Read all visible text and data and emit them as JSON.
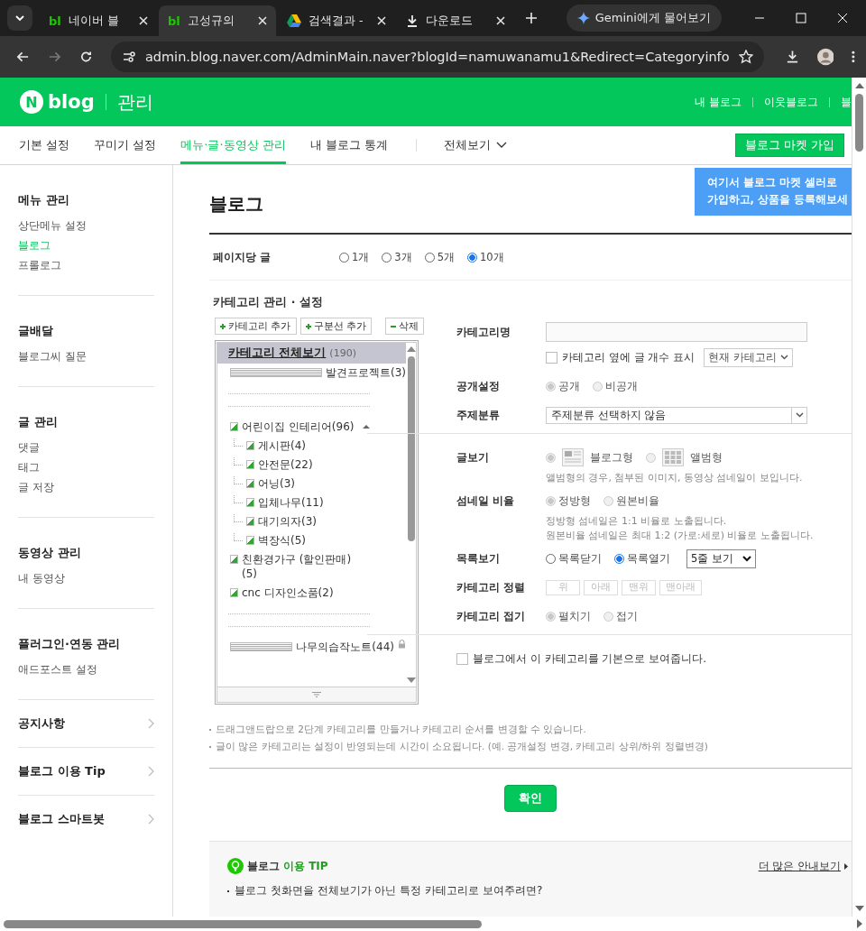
{
  "browser": {
    "tabs": [
      {
        "title": "네이버 블",
        "kind": "text",
        "icon_text": "bl",
        "selected": false
      },
      {
        "title": "고성규의",
        "kind": "text",
        "icon_text": "bl",
        "selected": true
      },
      {
        "title": "검색결과 -",
        "kind": "drive",
        "selected": false
      },
      {
        "title": "다운로드",
        "kind": "download",
        "selected": false
      }
    ],
    "ai_button": "Gemini에게 물어보기",
    "url": "admin.blog.naver.com/AdminMain.naver?blogId=namuwanamu1&Redirect=Categoryinfo"
  },
  "header": {
    "logo_letter": "N",
    "logo_word": "blog",
    "title": "관리",
    "links": [
      "내 블로그",
      "이웃블로그",
      "블"
    ]
  },
  "nav": {
    "items": [
      {
        "label": "기본 설정",
        "selected": false
      },
      {
        "label": "꾸미기 설정",
        "selected": false
      },
      {
        "label": "메뉴·글·동영상 관리",
        "selected": true
      },
      {
        "label": "내 블로그 통계",
        "selected": false
      }
    ],
    "dropdown": "전체보기",
    "market_button": "블로그 마켓 가입",
    "tooltip": "여기서 블로그 마켓 셀러로\n가입하고, 상품을 등록해보세"
  },
  "sidebar": [
    {
      "title": "메뉴 관리",
      "kind": "group",
      "items": [
        {
          "label": "상단메뉴 설정",
          "selected": false
        },
        {
          "label": "블로그",
          "selected": true
        },
        {
          "label": "프롤로그",
          "selected": false
        }
      ]
    },
    {
      "title": "글배달",
      "kind": "group",
      "items": [
        {
          "label": "블로그씨 질문",
          "selected": false
        }
      ]
    },
    {
      "title": "글 관리",
      "kind": "group",
      "items": [
        {
          "label": "댓글",
          "selected": false
        },
        {
          "label": "태그",
          "selected": false
        },
        {
          "label": "글 저장",
          "selected": false
        }
      ]
    },
    {
      "title": "동영상 관리",
      "kind": "group",
      "items": [
        {
          "label": "내 동영상",
          "selected": false
        }
      ]
    },
    {
      "title": "플러그인·연동 관리",
      "kind": "group",
      "items": [
        {
          "label": "애드포스트 설정",
          "selected": false
        }
      ]
    },
    {
      "title": "공지사항",
      "kind": "link"
    },
    {
      "title": "블로그 이용 Tip",
      "kind": "link"
    },
    {
      "title": "블로그 스마트봇",
      "kind": "link"
    }
  ],
  "page_title": "블로그",
  "per_page": {
    "label": "페이지당 글",
    "options": [
      {
        "label": "1개",
        "selected": false
      },
      {
        "label": "3개",
        "selected": false
      },
      {
        "label": "5개",
        "selected": false
      },
      {
        "label": "10개",
        "selected": true
      }
    ]
  },
  "category": {
    "title": "카테고리 관리 · 설정",
    "buttons": [
      {
        "label": "카테고리 추가",
        "kind": "add"
      },
      {
        "label": "구분선 추가",
        "kind": "add"
      },
      {
        "label": "삭제",
        "kind": "remove"
      }
    ],
    "root": {
      "label": "카테고리 전체보기",
      "count": "(190)",
      "selected": true
    },
    "items": [
      {
        "kind": "page",
        "label": "발견프로젝트(3)",
        "locked": false
      },
      {
        "kind": "divider"
      },
      {
        "kind": "divider"
      },
      {
        "kind": "board",
        "label": "어린이집 인테리어(96)",
        "locked": false,
        "expanded": true,
        "children": [
          {
            "kind": "board",
            "label": "게시판(4)",
            "locked": false
          },
          {
            "kind": "board",
            "label": "안전문(22)",
            "locked": false
          },
          {
            "kind": "board",
            "label": "어닝(3)",
            "locked": false
          },
          {
            "kind": "board",
            "label": "입체나무(11)",
            "locked": false
          },
          {
            "kind": "board",
            "label": "대기의자(3)",
            "locked": false
          },
          {
            "kind": "board",
            "label": "벽장식(5)",
            "locked": false
          }
        ]
      },
      {
        "kind": "board",
        "label": "친환경가구 (할인판매)(5)",
        "locked": false
      },
      {
        "kind": "board",
        "label": "cnc 디자인소품(2)",
        "locked": false
      },
      {
        "kind": "divider"
      },
      {
        "kind": "divider"
      },
      {
        "kind": "page",
        "label": "나무의습작노트(44)",
        "locked": true
      }
    ]
  },
  "form": {
    "name": {
      "label": "카테고리명"
    },
    "count": {
      "label": "카테고리 옆에 글 개수 표시",
      "checked": false,
      "select": "현재 카테고리"
    },
    "visibility": {
      "label": "공개설정",
      "disabled": true,
      "options": [
        {
          "label": "공개",
          "selected": true
        },
        {
          "label": "비공개",
          "selected": false
        }
      ]
    },
    "topic": {
      "label": "주제분류",
      "value": "주제분류 선택하지 않음"
    },
    "view": {
      "label": "글보기",
      "disabled": true,
      "options": [
        {
          "label": "블로그형",
          "selected": true,
          "kind": "blog"
        },
        {
          "label": "앨범형",
          "selected": false,
          "kind": "album"
        }
      ],
      "note": "앨범형의 경우, 첨부된 이미지, 동영상 섬네일이 보입니다."
    },
    "thumb": {
      "label": "섬네일 비율",
      "disabled": true,
      "options": [
        {
          "label": "정방형",
          "selected": true
        },
        {
          "label": "원본비율",
          "selected": false
        }
      ],
      "notes": [
        "정방형 섬네일은 1:1 비율로 노출됩니다.",
        "원본비율 섬네일은 최대 1:2 (가로:세로) 비율로 노출됩니다."
      ]
    },
    "list": {
      "label": "목록보기",
      "disabled": false,
      "options": [
        {
          "label": "목록닫기",
          "selected": false
        },
        {
          "label": "목록열기",
          "selected": true
        }
      ],
      "select": "5줄 보기"
    },
    "sort": {
      "label": "카테고리 정렬",
      "disabled": true,
      "buttons": [
        "위",
        "아래",
        "맨위",
        "맨아래"
      ]
    },
    "fold": {
      "label": "카테고리 접기",
      "disabled": true,
      "options": [
        {
          "label": "펼치기",
          "selected": true
        },
        {
          "label": "접기",
          "selected": false
        }
      ]
    },
    "default": {
      "label": "블로그에서 이 카테고리를 기본으로 보여줍니다.",
      "checked": false
    }
  },
  "notes": [
    "드래그앤드랍으로 2단계 카테고리를 만들거나 카테고리 순서를 변경할 수 있습니다.",
    "글이 많은 카테고리는 설정이 반영되는데 시간이 소요됩니다. (예. 공개설정 변경, 카테고리 상위/하위 정렬변경)"
  ],
  "confirm": "확인",
  "tip": {
    "title": "블로그",
    "title_accent": "이용 TIP",
    "more": "더 많은 안내보기",
    "items": [
      "블로그 첫화면을 전체보기가 아닌 특정 카테고리로 보여주려면?"
    ]
  }
}
